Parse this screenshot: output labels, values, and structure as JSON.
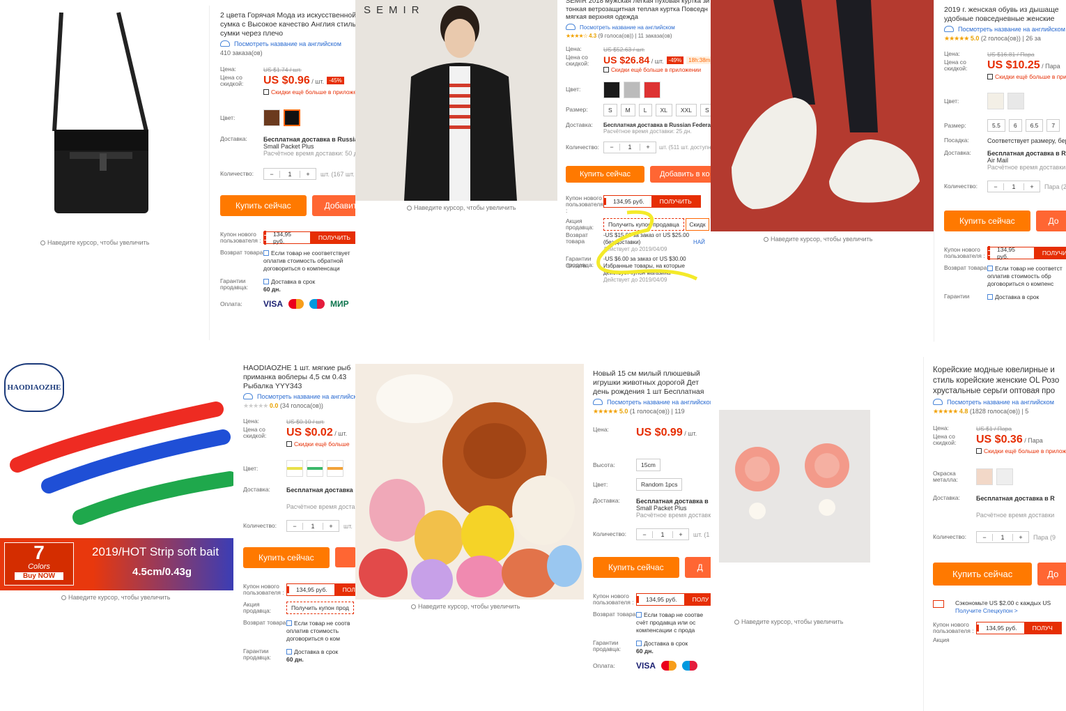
{
  "hint": "Наведите курсор, чтобы увеличить",
  "en": "Посмотреть название на английском",
  "labels": {
    "price": "Цена:",
    "disc_price": "Цена со скидкой:",
    "color": "Цвет:",
    "delivery": "Доставка:",
    "qty": "Количество:",
    "size": "Размер:",
    "coupon": "Купон нового пользователя :",
    "seller": "Акция продавца:",
    "return": "Возврат товара",
    "guarantee": "Гарантии продавца:",
    "pay": "Оплата:",
    "height": "Высота:",
    "fit": "Посадка:",
    "metal": "Окраска металла:"
  },
  "buy": "Купить сейчас",
  "get": "ПОЛУЧИТЬ",
  "coupon_val": "134,95 руб.",
  "app_disc": "Скидки ещё больше в приложении",
  "c1": {
    "title": "2 цвета Горячая Мода из искусственной\nсумка с Высокое качество Англия стиль\nсумки через плечо",
    "orders": "410 заказа(ов)",
    "old": "US $1.74 / шт.",
    "price": "US $0.96",
    "unit": "/ шт.",
    "disc": "-45%",
    "ship": "Бесплатная доставка в Russian",
    "ship2": "Small Packet Plus",
    "eta": "Расчётное время доставки: 50 д",
    "stock": "шт. (167 шт.",
    "add": "Добавить",
    "ret": "Если товар не соответствует\nоплатив стоимость обратной\nдоговориться о компенсаци",
    "gua": "Доставка в срок",
    "days": "60 дн.",
    "cards": [
      "VISA",
      "",
      "",
      "МИР"
    ]
  },
  "c2": {
    "brand": "SEMIR"
  },
  "c3": {
    "title": "SEMIR 2018 мужская легкая пуховая куртка зи\nтонкая ветрозащитная теплая куртка Повседн\nмягкая верхняя одежда",
    "rating": "4.3",
    "votes": "(9 голоса(ов))",
    "orders": "11 заказа(ов)",
    "old": "US $52.63 / шт.",
    "price": "US $26.84",
    "unit": "/ шт.",
    "disc": "-49%",
    "timer": "18h:38m",
    "sizes": [
      "S",
      "M",
      "L",
      "XL",
      "XXL",
      "S"
    ],
    "ship": "Бесплатная доставка в Russian Federati",
    "eta": "Расчётное время доставки: 25 дн.",
    "stock": "шт. (511 шт. доступно)",
    "add": "Добавить в ко",
    "seller_btn": "Получить купон продавца",
    "skid": "Скидк",
    "promo1": "-US $15.00 за заказ от US $25.00\n(без доставки)",
    "valid1": "Действует до 2019/04/09",
    "find": "НАЙ",
    "promo2": "-US $6.00 за заказ от US $30.00\nИзбранные товары, на которые\nдействует купон магазина",
    "valid2": "Действует до 2019/04/09"
  },
  "c4": {
    "title": "2019 г. женская обувь из дышаще\nудобные повседневные женские",
    "rating": "5.0",
    "votes": "(2 голоса(ов))",
    "orders": "26 за",
    "old": "US $16.81 / Пара",
    "price": "US $10.25",
    "unit": "/ Пара",
    "sizes": [
      "5.5",
      "6",
      "6.5",
      "7"
    ],
    "fit": "Соответствует размеру, бер",
    "ship": "Бесплатная доставка в R",
    "ship2": "Air Mail",
    "eta": "Расчётное время доставки",
    "stock": "Пара (2",
    "add": "До",
    "ret": "Если товар не соответст\nоплатив стоимость обр\nдоговориться о компенс",
    "gua": "Доставка в срок",
    "gua_lbl": "Гарантии"
  },
  "c5": {
    "brand": "HAODIAOZHE",
    "banner_num": "7",
    "banner_colors": "Colors",
    "banner_buy": "Buy NOW",
    "banner_txt": "2019/HOT Strip soft bait",
    "banner_size": "4.5cm/0.43g",
    "title": "HAODIAOZHE 1 шт. мягкие рыб\nприманка воблеры 4,5 см 0.43\nРыбалка YYY343",
    "rating": "0.0",
    "votes": "(34 голоса(ов))",
    "old": "US $0.10 / шт.",
    "price": "US $0.02",
    "unit": "/ шт.",
    "app": "Скидки ещё больше",
    "ship": "Бесплатная доставка",
    "eta": "Расчётное время доста",
    "stock": "шт.",
    "get": "ПОЛ",
    "seller_btn": "Получить купон прод",
    "ret": "Если товар не соотв\nоплатив стоимость\nдоговориться о ком",
    "gua": "Доставка в срок",
    "days": "60 дн."
  },
  "c6": {},
  "c7": {
    "title": "Новый 15 см милый плюшевый\nигрушки животных дорогой Дет\nдень рождения 1 шт Бесплатная",
    "rating": "5.0",
    "votes": "(1 голоса(ов))",
    "orders": "119",
    "price": "US $0.99",
    "unit": "/ шт.",
    "height_v": "15cm",
    "color_v": "Random 1pcs",
    "ship": "Бесплатная доставка в",
    "ship2": "Small Packet Plus",
    "eta": "Расчётное время доставк",
    "stock": "шт. (1",
    "add": "Д",
    "get": "ПОЛУ",
    "ret": "Если товар не соотве\nсчёт продавца или ос\nкомпенсации с прода",
    "gua": "Доставка в срок",
    "days": "60 дн.",
    "cards": [
      "VISA",
      "",
      ""
    ]
  },
  "c8": {
    "title": "Корейские модные ювелирные и\nстиль корейские женские OL Розо\nхрустальные серьги оптовая про",
    "rating": "4.8",
    "votes": "(1828 голоса(ов))",
    "orders": "5",
    "old": "US $1 / Пара",
    "price": "US $0.36",
    "unit": "/ Пара",
    "ship": "Бесплатная доставка в R",
    "eta": "Расчётное время доставки",
    "stock": "Пара (9",
    "add": "До",
    "save": "Сэкономьте US $2.00 с каждых US",
    "special": "Получите Спецкупон >",
    "get": "ПОЛУЧ",
    "more": "Акция"
  },
  "colors": {
    "orange": "#ff7900",
    "red": "#e62e04",
    "blue": "#2a6bd1",
    "star": "#f2a100",
    "highlight": "#f4ea2a"
  }
}
